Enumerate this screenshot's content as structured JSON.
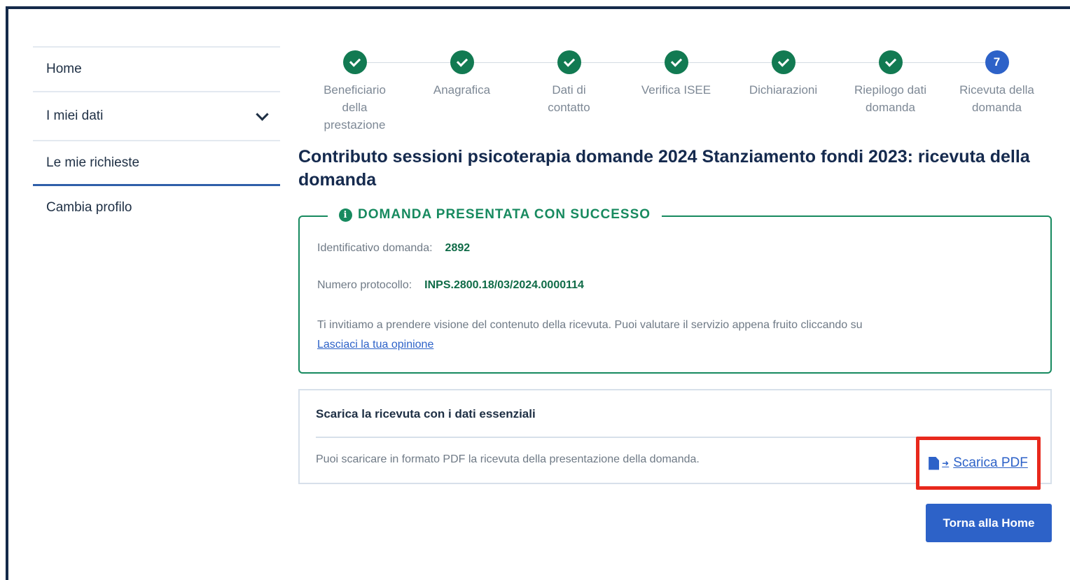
{
  "sidebar": {
    "items": [
      {
        "label": "Home"
      },
      {
        "label": "I miei dati"
      },
      {
        "label": "Le mie richieste"
      },
      {
        "label": "Cambia profilo"
      }
    ]
  },
  "stepper": {
    "steps": [
      {
        "label": "Beneficiario della prestazione",
        "status": "done"
      },
      {
        "label": "Anagrafica",
        "status": "done"
      },
      {
        "label": "Dati di contatto",
        "status": "done"
      },
      {
        "label": "Verifica ISEE",
        "status": "done"
      },
      {
        "label": "Dichiarazioni",
        "status": "done"
      },
      {
        "label": "Riepilogo dati domanda",
        "status": "done"
      },
      {
        "label": "Ricevuta della domanda",
        "status": "current",
        "number": "7"
      }
    ]
  },
  "page": {
    "title": "Contributo sessioni psicoterapia domande 2024 Stanziamento fondi 2023: ricevuta della domanda"
  },
  "success": {
    "legend": "DOMANDA PRESENTATA CON SUCCESSO",
    "id_label": "Identificativo domanda:",
    "id_value": "2892",
    "protocol_label": "Numero protocollo:",
    "protocol_value": "INPS.2800.18/03/2024.0000114",
    "invite_text": "Ti invitiamo a prendere visione del contenuto della ricevuta. Puoi valutare il servizio appena fruito cliccando su",
    "feedback_link": "Lasciaci la tua opinione"
  },
  "download": {
    "title": "Scarica la ricevuta con i dati essenziali",
    "description": "Puoi scaricare in formato PDF la ricevuta della presentazione della domanda.",
    "pdf_link": "Scarica PDF"
  },
  "actions": {
    "home_button": "Torna alla Home"
  },
  "colors": {
    "primary": "#2d62c8",
    "success": "#178a5f",
    "highlight": "#e8281c",
    "title": "#152a4e"
  }
}
